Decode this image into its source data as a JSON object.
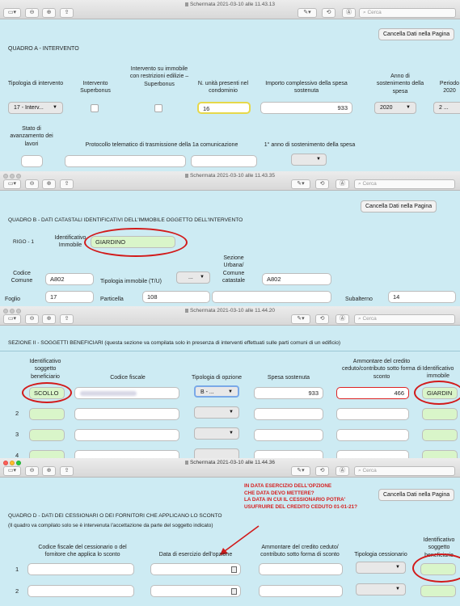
{
  "common": {
    "search_placeholder": "Cerca",
    "clear_button": "Cancella Dati nella Pagina"
  },
  "win1": {
    "title": "Schermata 2021-03-10 alle 11.43.13",
    "section": "QUADRO A - INTERVENTO",
    "cols": {
      "tipologia": "Tipologia di intervento",
      "superbonus": "Intervento Superbonus",
      "restrizioni": "Intervento su immobile con restrizioni edilizie – Superbonus",
      "unita": "N. unità presenti nel condominio",
      "importo": "Importo complessivo della spesa sostenuta",
      "anno": "Anno di sostenimento della spesa",
      "periodo": "Periodo 2020"
    },
    "values": {
      "tipologia": "17 - Interv...",
      "unita": "16",
      "importo": "933",
      "anno": "2020",
      "periodo": "2 ..."
    },
    "row2": {
      "stato": "Stato di avanzamento dei lavori",
      "protocollo": "Protocollo telematico di trasmissione della 1a comunicazione",
      "primo_anno": "1° anno di sostenimento della spesa"
    }
  },
  "win2": {
    "title": "Schermata 2021-03-10 alle 11.43.35",
    "section": "QUADRO B - DATI CATASTALI IDENTIFICATIVI DELL'IMMOBILE OGGETTO DELL'INTERVENTO",
    "rigo": "RIGO - 1",
    "ident_label": "Identificativo Immobile",
    "ident_value": "GIARDINO",
    "codice_comune_label": "Codice Comune",
    "codice_comune_value": "A802",
    "tipologia_label": "Tipologia immobile (T/U)",
    "tipologia_value": "...",
    "sezione_label": "Sezione Urbana/ Comune catastale",
    "sezione_value": "A802",
    "foglio_label": "Foglio",
    "foglio_value": "17",
    "particella_label": "Particella",
    "particella_value": "108",
    "subalterno_label": "Subalterno",
    "subalterno_value": "14"
  },
  "win3": {
    "title": "Schermata 2021-03-10 alle 11.44.20",
    "section": "SEZIONE II - SOGGETTI BENEFICIARI (questa sezione va compilata solo in presenza di interventi effettuati sulle parti comuni di un edificio)",
    "cols": {
      "ident": "Identificativo soggetto beneficiario",
      "cf": "Codice fiscale",
      "tipologia": "Tipologia di opzione",
      "spesa": "Spesa sostenuta",
      "ammontare": "Ammontare del credito ceduto/contributo sotto forma di sconto",
      "immobile": "Identificativo immobile"
    },
    "row1": {
      "ident": "SCOLLO",
      "tipologia": "B - ...",
      "spesa": "933",
      "ammontare": "466",
      "immobile": "GIARDIN"
    },
    "row_numbers": [
      "2",
      "3",
      "4"
    ]
  },
  "win4": {
    "title": "Schermata 2021-03-10 alle 11.44.36",
    "note": [
      "IN DATA ESERCIZIO DELL'OPZIONE",
      "CHE DATA DEVO METTERE?",
      "LA DATA IN CUI IL CESSIONARIO POTRA'",
      "USUFRUIRE DEL CREDITO CEDUTO 01-01-21?"
    ],
    "section": "QUADRO D - DATI DEI CESSIONARI O DEI FORNITORI CHE APPLICANO LO SCONTO",
    "subtitle": "(Il quadro va compilato solo se è intervenuta l'accettazione da parte del soggetto indicato)",
    "cols": {
      "cf": "Codice fiscale del cessionario o del fornitore che applica lo sconto",
      "data": "Data di esercizio dell'opzione",
      "ammontare": "Ammontare del credito ceduto/ contributo sotto forma di sconto",
      "tipologia": "Tipologia cessionario",
      "ident": "Identificativo soggetto beneficiario"
    },
    "row_numbers": [
      "1",
      "2"
    ]
  }
}
